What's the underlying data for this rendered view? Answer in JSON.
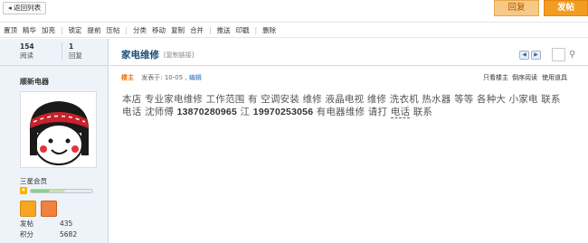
{
  "top": {
    "back_label": "◂ 返回列表",
    "reply_label": "回复",
    "post_label": "发帖"
  },
  "modbar": {
    "items": [
      "置顶",
      "精华",
      "加亮",
      "|",
      "锁定",
      "提前",
      "压帖",
      "|",
      "分类",
      "移动",
      "复制",
      "合并",
      "|",
      "推送",
      "印戳",
      "|",
      "删除"
    ]
  },
  "sidebar": {
    "views_value": "154",
    "views_label": "阅读",
    "replies_value": "1",
    "replies_label": "回复",
    "username": "顺新电器",
    "group": "三星会员",
    "posts_label": "发帖",
    "posts_value": "435",
    "credits_label": "积分",
    "credits_value": "5682"
  },
  "thread": {
    "title": "家电维修",
    "copy_link": "[复制链接]",
    "author_tag": "楼主",
    "posted_at": "发表于: 10-05 ,",
    "edit": "编辑",
    "only_author": "只看楼主",
    "reverse": "倒序阅读",
    "use_tool": "使用道具",
    "content_part1": "本店 专业家电维修  工作范围  有  空调安装  维修   液晶电视  维修  洗衣机  热水器  等等 各种大 小家电  联系电话  沈师傅 ",
    "phone1": "13870280965",
    "content_part2": " 江  ",
    "phone2": "19970253056",
    "content_part3": "  有电器维修   请打 ",
    "content_dashed": "电话",
    "content_part4": " 联系"
  },
  "colors": {
    "accent_orange": "#f29c20",
    "sidebar_bg": "#eef3fa",
    "title_blue": "#1a4e7a"
  },
  "icons": {
    "prev": "arrow-left-icon",
    "next": "arrow-right-icon",
    "tools": "wrench-icon"
  }
}
